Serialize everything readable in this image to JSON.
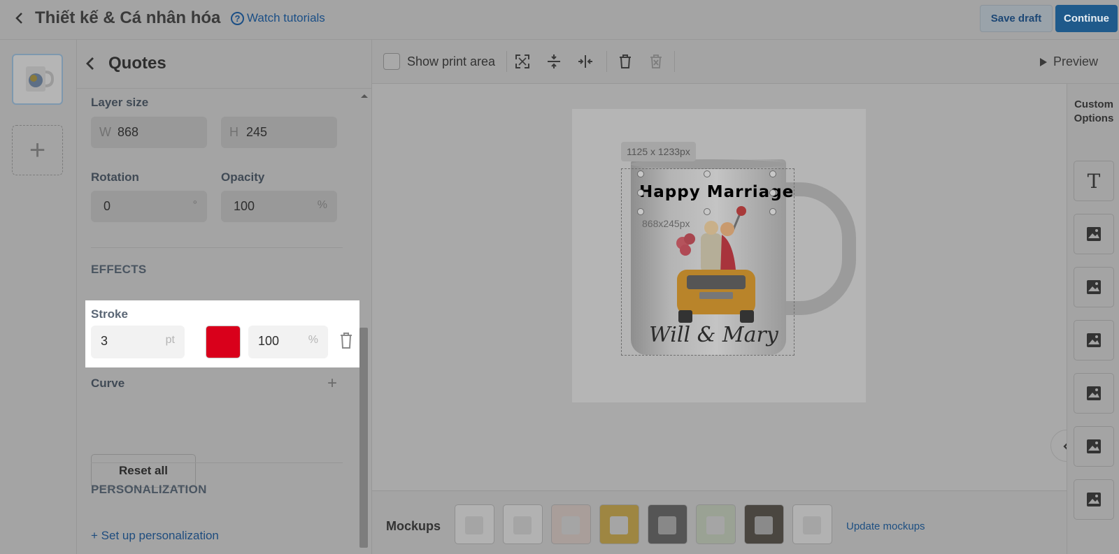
{
  "header": {
    "title": "Thiết kế & Cá nhân hóa",
    "watch_tutorials": "Watch tutorials",
    "save_draft": "Save draft",
    "continue": "Continue"
  },
  "panel": {
    "title": "Quotes",
    "layer_size_label": "Layer size",
    "width_prefix": "W",
    "width_value": "868",
    "height_prefix": "H",
    "height_value": "245",
    "rotation_label": "Rotation",
    "rotation_value": "0",
    "rotation_unit": "°",
    "opacity_label": "Opacity",
    "opacity_value": "100",
    "opacity_unit": "%",
    "effects_label": "EFFECTS",
    "stroke_label": "Stroke",
    "stroke_width_value": "3",
    "stroke_width_unit": "pt",
    "stroke_color": "#d9001b",
    "stroke_opacity_value": "100",
    "stroke_opacity_unit": "%",
    "curve_label": "Curve",
    "reset_all": "Reset all",
    "personalization_label": "PERSONALIZATION",
    "setup_personalization": "+ Set up personalization"
  },
  "toolbar": {
    "show_print_area": "Show print area",
    "preview": "Preview"
  },
  "canvas": {
    "size_tag": "1125 x 1233px",
    "layer_dims": "868x245px",
    "quote_text": "Happy Marriage",
    "names_text": "Will & Mary"
  },
  "mockups": {
    "label": "Mockups",
    "update_link": "Update mockups",
    "count": 8
  },
  "right": {
    "custom_options_line1": "Custom",
    "custom_options_line2": "Options"
  },
  "icons": [
    "chevron-left-icon",
    "question-icon",
    "trash-icon",
    "plus-icon",
    "expand-icon",
    "align-vertical-icon",
    "align-horizontal-icon",
    "play-icon",
    "text-icon",
    "image-icon"
  ]
}
